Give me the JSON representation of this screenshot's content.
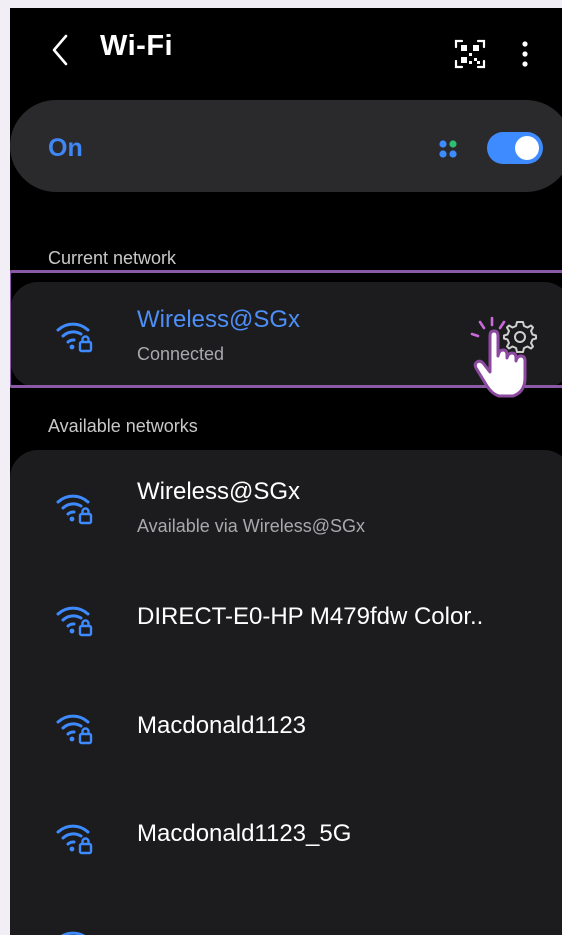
{
  "header": {
    "title": "Wi-Fi",
    "back_icon": "back-chevron-icon",
    "qr_icon": "qr-code-icon",
    "more_icon": "more-vertical-icon"
  },
  "wifi_switch": {
    "label": "On",
    "enabled": true,
    "accent_color": "#3e8bff"
  },
  "current_section": {
    "label": "Current network",
    "network": {
      "name": "Wireless@SGx",
      "status": "Connected",
      "icon": "wifi-lock-icon",
      "settings_icon": "gear-icon"
    }
  },
  "available_section": {
    "label": "Available networks",
    "networks": [
      {
        "name": "Wireless@SGx",
        "sub": "Available via Wireless@SGx"
      },
      {
        "name": "DIRECT-E0-HP M479fdw Color..",
        "sub": ""
      },
      {
        "name": "Macdonald1123",
        "sub": ""
      },
      {
        "name": "Macdonald1123_5G",
        "sub": ""
      }
    ]
  }
}
